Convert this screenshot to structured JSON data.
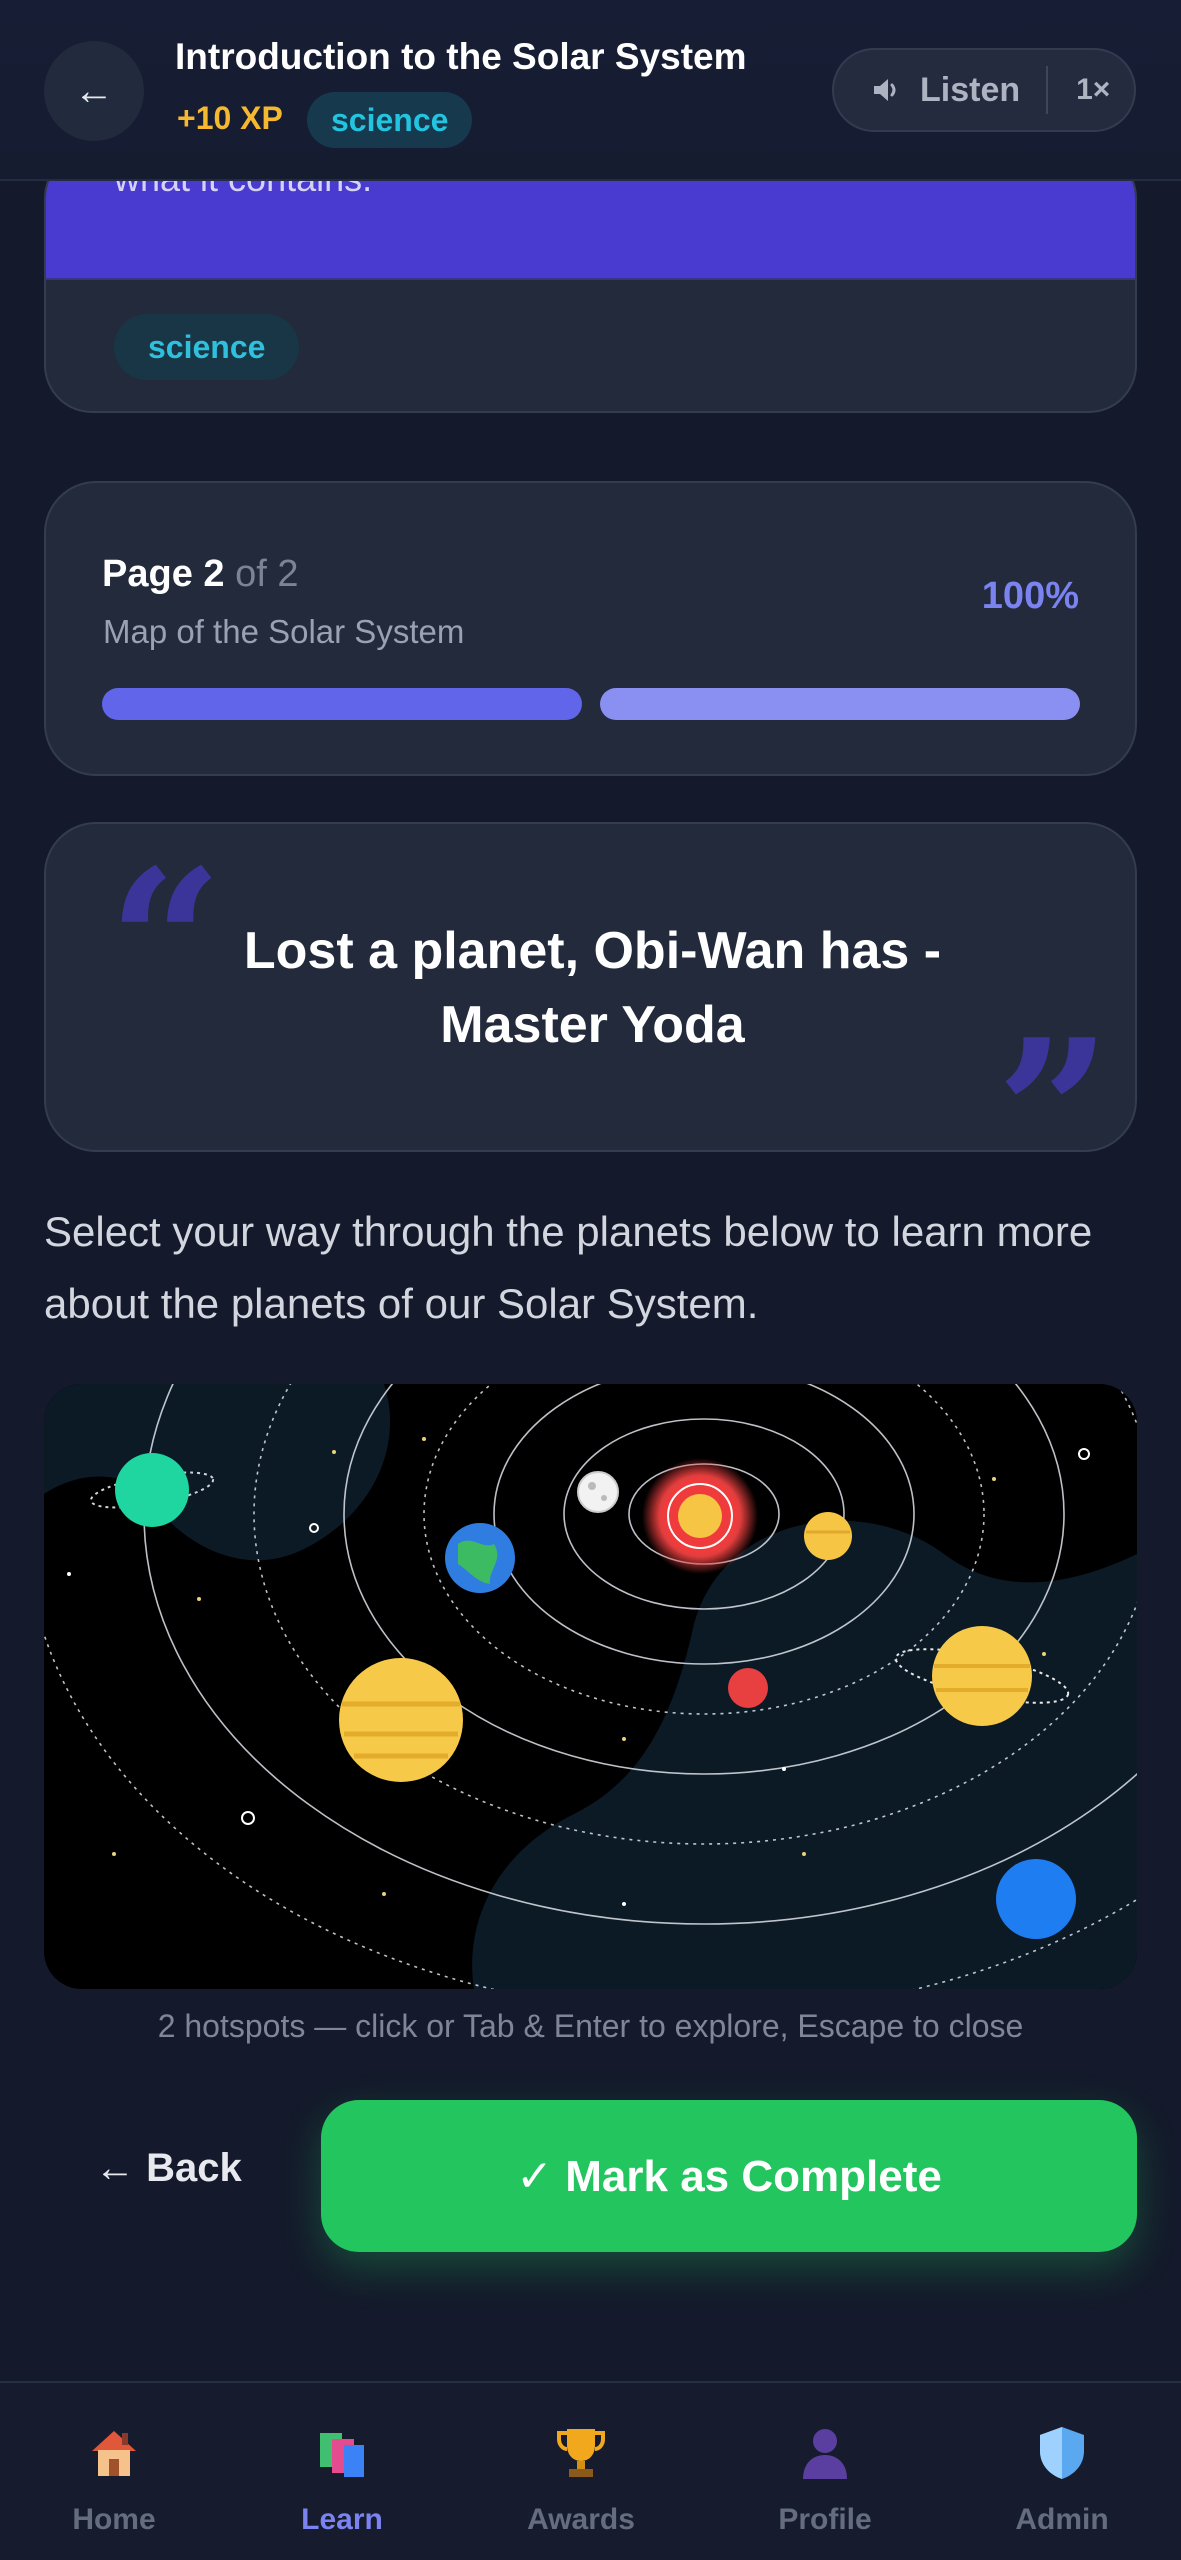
{
  "header": {
    "back_icon": "←",
    "title": "Introduction to the Solar System",
    "xp": "+10 XP",
    "tag": "science",
    "listen_label": "Listen",
    "speed": "1×"
  },
  "top_card": {
    "banner_text": "what it contains.",
    "tag": "science"
  },
  "progress": {
    "page_word": "Page 2",
    "of_text": "of 2",
    "subtitle": "Map of the Solar System",
    "percent_label": "100%",
    "percent": 100,
    "segments": [
      1,
      1
    ]
  },
  "quote": {
    "open_mark": "“",
    "close_mark": "”",
    "line1": "Lost a planet, Obi-Wan has -",
    "line2": "Master Yoda"
  },
  "intro_text": "Select your way through the planets below to learn more about the planets of our Solar System.",
  "map": {
    "hint": "2 hotspots — click or Tab & Enter to explore, Escape to close"
  },
  "actions": {
    "back_label": "← Back",
    "complete_label": "✓ Mark as Complete"
  },
  "nav": {
    "items": [
      {
        "label": "Home",
        "icon": "home-icon"
      },
      {
        "label": "Learn",
        "icon": "books-icon",
        "active": true
      },
      {
        "label": "Awards",
        "icon": "trophy-icon"
      },
      {
        "label": "Profile",
        "icon": "user-icon"
      },
      {
        "label": "Admin",
        "icon": "shield-icon"
      }
    ]
  },
  "colors": {
    "accent": "#6366f1",
    "success": "#22c55e",
    "xp": "#f5b82e",
    "tag": "#22c4e0"
  }
}
